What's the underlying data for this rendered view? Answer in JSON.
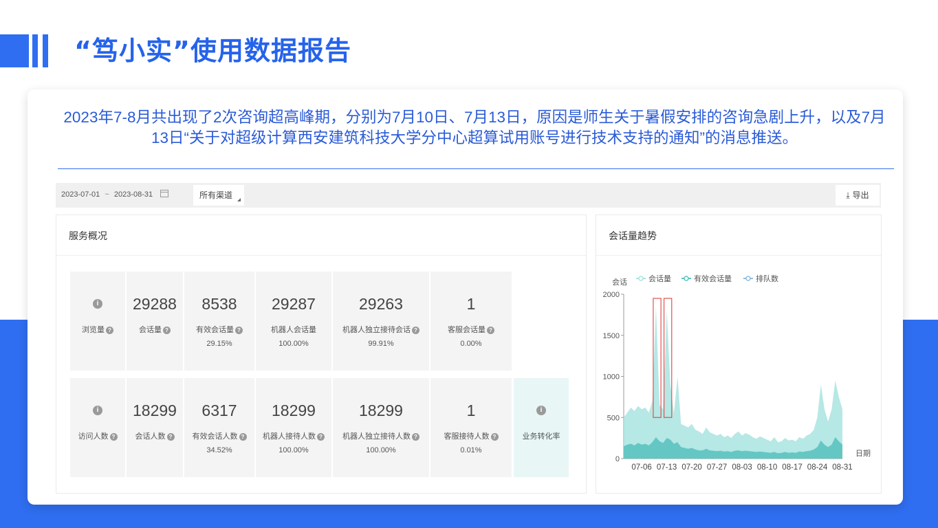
{
  "page": {
    "title": "“笃小实”使用数据报告",
    "summary": "2023年7-8月共出现了2次咨询超高峰期，分别为7月10日、7月13日，原因是师生关于暑假安排的咨询急剧上升，以及7月13日“关于对超级计算西安建筑科技大学分中心超算试用账号进行技术支持的通知”的消息推送。"
  },
  "filter": {
    "date_start": "2023-07-01",
    "date_sep": "~",
    "date_end": "2023-08-31",
    "channel": "所有渠道",
    "export_label": "导出",
    "export_icon": "download-icon",
    "calendar_icon": "calendar-icon"
  },
  "overview": {
    "title": "服务概况",
    "row1": [
      {
        "icon": "info-icon",
        "label": "浏览量"
      },
      {
        "value": "29288",
        "label": "会话量"
      },
      {
        "value": "8538",
        "label": "有效会话量",
        "pct": "29.15%"
      },
      {
        "value": "29287",
        "label": "机器人会话量",
        "pct": "100.00%"
      },
      {
        "value": "29263",
        "label": "机器人独立接待会话",
        "pct": "99.91%"
      },
      {
        "value": "1",
        "label": "客服会话量",
        "pct": "0.00%"
      }
    ],
    "row2": [
      {
        "icon": "info-icon",
        "label": "访问人数"
      },
      {
        "value": "18299",
        "label": "会话人数"
      },
      {
        "value": "6317",
        "label": "有效会话人数",
        "pct": "34.52%"
      },
      {
        "value": "18299",
        "label": "机器人接待人数",
        "pct": "100.00%"
      },
      {
        "value": "18299",
        "label": "机器人独立接待人数",
        "pct": "100.00%"
      },
      {
        "value": "1",
        "label": "客服接待人数",
        "pct": "0.01%"
      },
      {
        "icon": "info-icon",
        "label": "业务转化率"
      }
    ]
  },
  "trend": {
    "title": "会话量趋势",
    "colors": {
      "session": "#a9e4e0",
      "effective": "#5bc3c0",
      "queue": "#8fbbe0",
      "highlight": "#e05050"
    }
  },
  "chart_data": {
    "type": "area",
    "ylabel": "会话",
    "xlabel": "日期",
    "ylim": [
      0,
      2000
    ],
    "yticks": [
      "0",
      "500",
      "1000",
      "1500",
      "2000"
    ],
    "xticks": [
      "07-06",
      "07-13",
      "07-20",
      "07-27",
      "08-03",
      "08-10",
      "08-17",
      "08-24",
      "08-31"
    ],
    "x": [
      "07-01",
      "07-02",
      "07-03",
      "07-04",
      "07-05",
      "07-06",
      "07-07",
      "07-08",
      "07-09",
      "07-10",
      "07-11",
      "07-12",
      "07-13",
      "07-14",
      "07-15",
      "07-16",
      "07-17",
      "07-18",
      "07-19",
      "07-20",
      "07-21",
      "07-22",
      "07-23",
      "07-24",
      "07-25",
      "07-26",
      "07-27",
      "07-28",
      "07-29",
      "07-30",
      "07-31",
      "08-01",
      "08-02",
      "08-03",
      "08-04",
      "08-05",
      "08-06",
      "08-07",
      "08-08",
      "08-09",
      "08-10",
      "08-11",
      "08-12",
      "08-13",
      "08-14",
      "08-15",
      "08-16",
      "08-17",
      "08-18",
      "08-19",
      "08-20",
      "08-21",
      "08-22",
      "08-23",
      "08-24",
      "08-25",
      "08-26",
      "08-27",
      "08-28",
      "08-29",
      "08-30",
      "08-31"
    ],
    "series": [
      {
        "name": "会话量",
        "values": [
          500,
          560,
          620,
          580,
          640,
          600,
          620,
          560,
          700,
          1850,
          650,
          600,
          1800,
          900,
          550,
          1000,
          420,
          400,
          380,
          420,
          350,
          330,
          300,
          380,
          320,
          300,
          280,
          300,
          260,
          280,
          250,
          300,
          330,
          280,
          310,
          290,
          260,
          240,
          270,
          250,
          230,
          210,
          260,
          200,
          210,
          250,
          220,
          230,
          210,
          260,
          240,
          280,
          300,
          350,
          500,
          900,
          600,
          450,
          600,
          950,
          750,
          600
        ]
      },
      {
        "name": "有效会话量",
        "values": [
          150,
          170,
          180,
          160,
          190,
          170,
          180,
          160,
          200,
          260,
          210,
          190,
          250,
          230,
          180,
          200,
          140,
          130,
          120,
          130,
          110,
          100,
          100,
          120,
          100,
          95,
          90,
          95,
          85,
          90,
          80,
          95,
          100,
          90,
          95,
          90,
          85,
          80,
          85,
          80,
          75,
          70,
          80,
          65,
          70,
          80,
          70,
          75,
          70,
          85,
          80,
          90,
          95,
          110,
          140,
          220,
          170,
          140,
          170,
          260,
          210,
          170
        ]
      },
      {
        "name": "排队数",
        "values": [
          0,
          0,
          0,
          0,
          0,
          0,
          0,
          0,
          0,
          0,
          0,
          0,
          0,
          0,
          0,
          0,
          0,
          0,
          0,
          0,
          0,
          0,
          0,
          0,
          0,
          0,
          0,
          0,
          0,
          0,
          0,
          0,
          0,
          0,
          0,
          0,
          0,
          0,
          0,
          0,
          0,
          0,
          0,
          0,
          0,
          0,
          0,
          0,
          0,
          0,
          0,
          0,
          0,
          0,
          0,
          0,
          0,
          0,
          0,
          0,
          0,
          0
        ]
      }
    ],
    "highlights": [
      {
        "from": "07-10",
        "to": "07-11"
      },
      {
        "from": "07-13",
        "to": "07-14"
      }
    ],
    "legend": "top",
    "grid": false
  }
}
